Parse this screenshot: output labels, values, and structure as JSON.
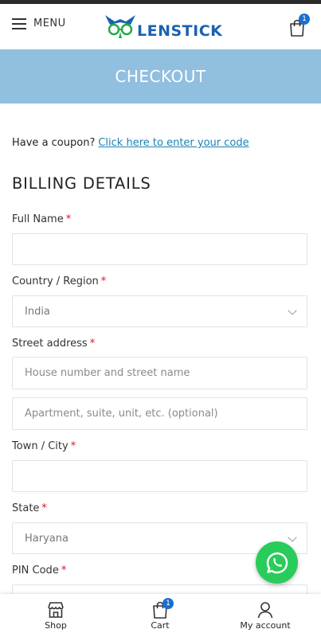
{
  "header": {
    "menu_label": "MENU",
    "logo_text": "LENSTICK",
    "cart_count": "1"
  },
  "banner": {
    "title": "CHECKOUT"
  },
  "coupon": {
    "prompt": "Have a coupon?",
    "link": "Click here to enter your code"
  },
  "billing": {
    "title": "BILLING DETAILS",
    "full_name": {
      "label": "Full Name",
      "required": "*",
      "value": ""
    },
    "country": {
      "label": "Country / Region",
      "required": "*",
      "value": "India"
    },
    "street": {
      "label": "Street address",
      "required": "*",
      "placeholder1": "House number and street name",
      "placeholder2": "Apartment, suite, unit, etc. (optional)"
    },
    "town": {
      "label": "Town / City",
      "required": "*",
      "value": ""
    },
    "state": {
      "label": "State",
      "required": "*",
      "value": "Haryana"
    },
    "pin": {
      "label": "PIN Code",
      "required": "*",
      "value": ""
    }
  },
  "bottom_nav": {
    "shop": "Shop",
    "cart": "Cart",
    "cart_count": "1",
    "account": "My account"
  },
  "colors": {
    "banner": "#90bfdf",
    "link": "#1a82b4",
    "brand": "#1a62b0",
    "whatsapp": "#29cc5b",
    "required": "#e01020"
  }
}
